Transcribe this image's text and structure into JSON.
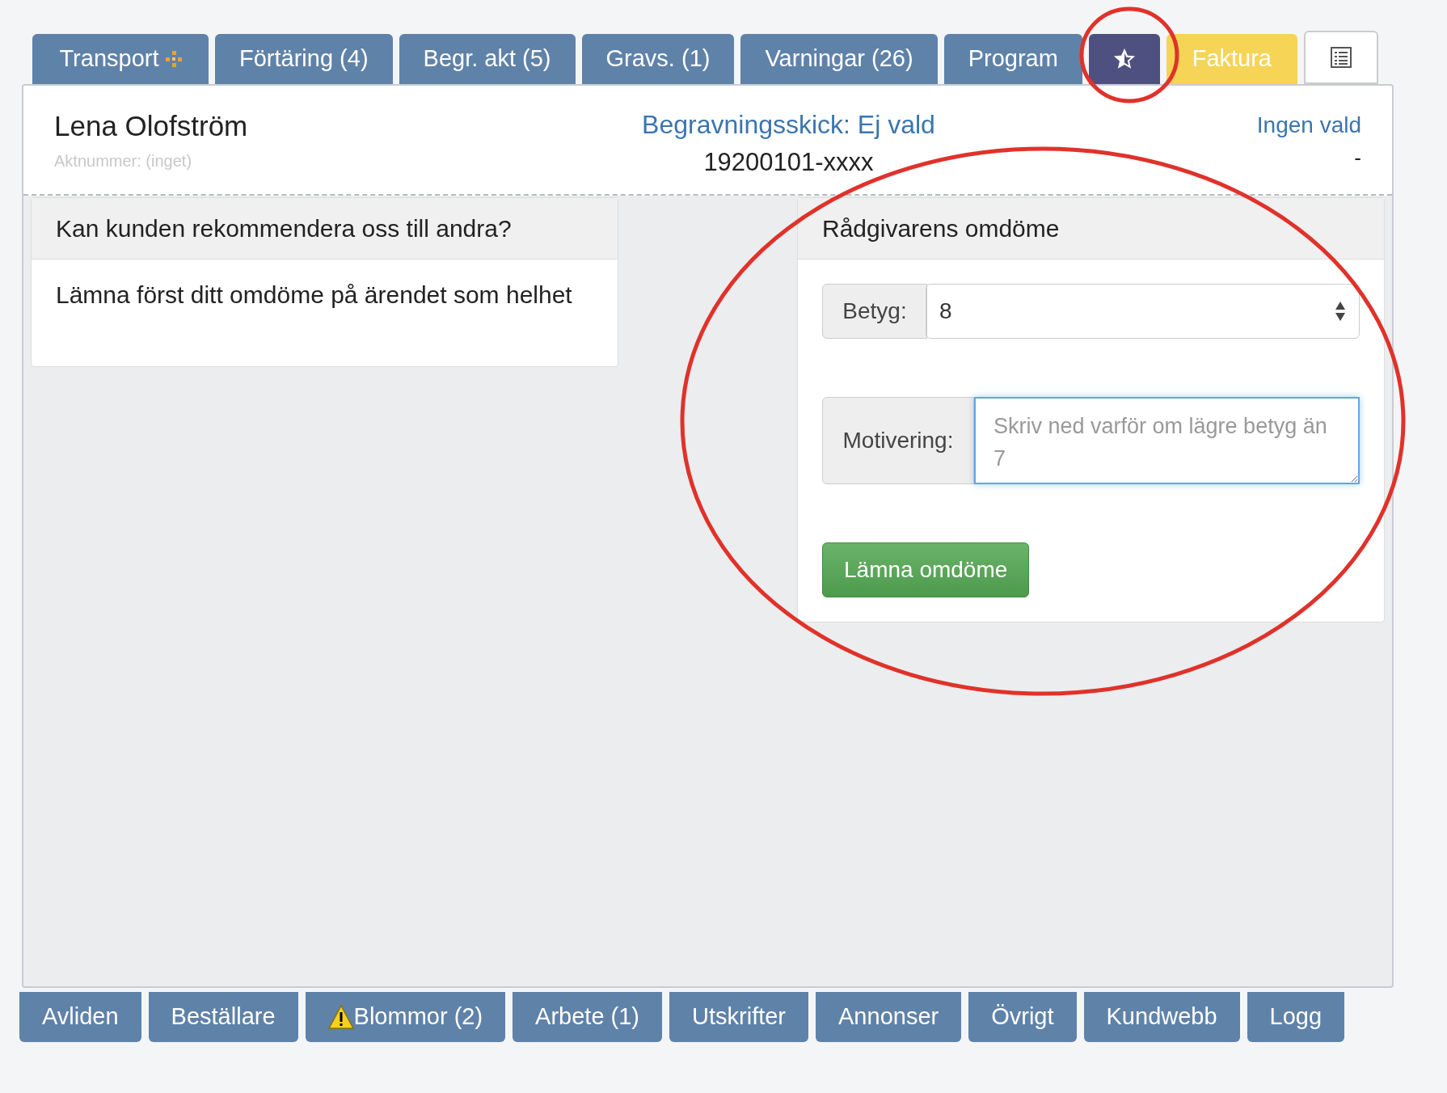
{
  "top_tabs": [
    {
      "kind": "text_with_mark",
      "label": "Transport",
      "selected": false
    },
    {
      "kind": "text",
      "label": "Förtäring (4)",
      "selected": false
    },
    {
      "kind": "text",
      "label": "Begr. akt (5)",
      "selected": false
    },
    {
      "kind": "text",
      "label": "Gravs. (1)",
      "selected": false
    },
    {
      "kind": "text",
      "label": "Varningar (26)",
      "selected": false
    },
    {
      "kind": "text",
      "label": "Program",
      "selected": false
    },
    {
      "kind": "star",
      "selected": true
    },
    {
      "kind": "accent",
      "label": "Faktura",
      "selected": false
    },
    {
      "kind": "list",
      "selected": false
    }
  ],
  "header": {
    "name": "Lena Olofström",
    "case_number": "Aktnummer: (inget)",
    "burial_type": "Begravningsskick: Ej vald",
    "id_number": "19200101-xxxx",
    "right_link": "Ingen vald",
    "right_value": "-"
  },
  "left_card": {
    "title": "Kan kunden rekommendera oss till andra?",
    "text": "Lämna först ditt omdöme på ärendet som helhet"
  },
  "right_card": {
    "title": "Rådgivarens omdöme",
    "grade_label": "Betyg:",
    "grade_value": "8",
    "motivation_label": "Motivering:",
    "motivation_placeholder": "Skriv ned varför om lägre betyg än 7",
    "motivation_focused": true,
    "submit": "Lämna omdöme"
  },
  "bottom_tabs": [
    {
      "label": "Avliden",
      "warning": false
    },
    {
      "label": "Beställare",
      "warning": false
    },
    {
      "label": "Blommor (2)",
      "warning": true
    },
    {
      "label": "Arbete (1)",
      "warning": false
    },
    {
      "label": "Utskrifter",
      "warning": false
    },
    {
      "label": "Annonser",
      "warning": false
    },
    {
      "label": "Övrigt",
      "warning": false
    },
    {
      "label": "Kundwebb",
      "warning": false
    },
    {
      "label": "Logg",
      "warning": false
    }
  ]
}
